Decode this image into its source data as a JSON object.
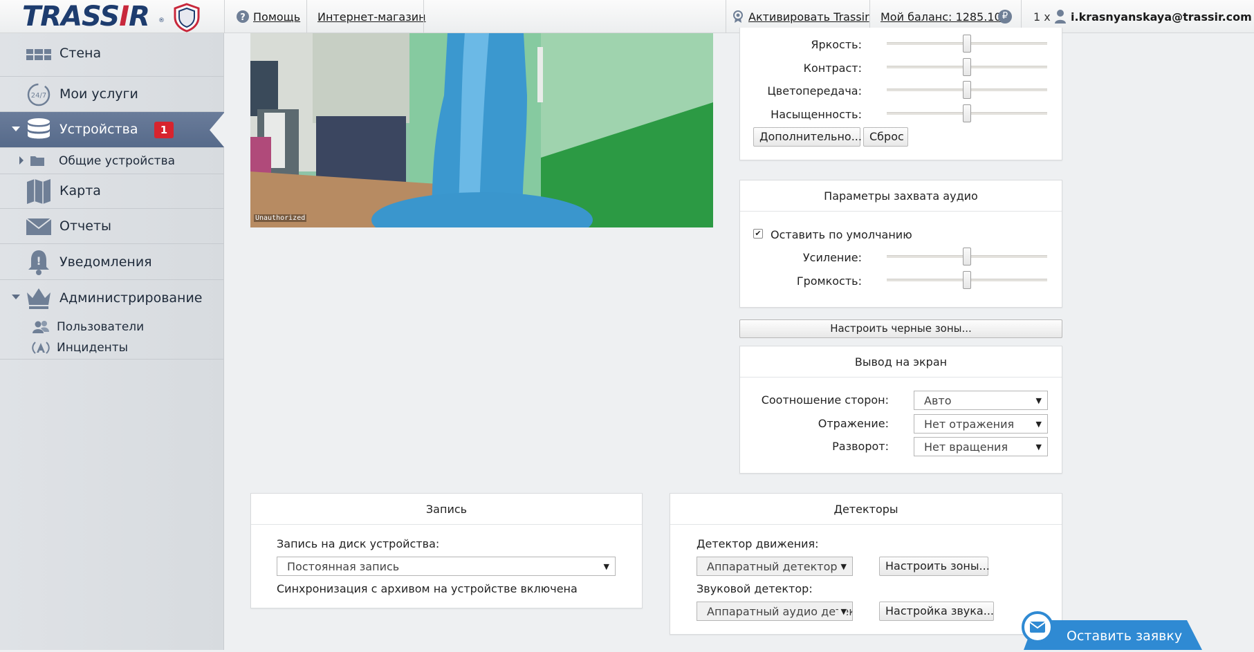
{
  "topbar": {
    "brand": "TRASSIR",
    "help": "Помощь",
    "shop": "Интернет-магазин",
    "activate": "Активировать Trassir",
    "balance": "Мой баланс: 1285.10",
    "currency": "₽",
    "user_count": "1 x",
    "email": "i.krasnyanskaya@trassir.com"
  },
  "sidebar": {
    "items": [
      {
        "label": "Стена",
        "icon": "wall-icon"
      },
      {
        "label": "Мои услуги",
        "icon": "services-24-7-icon"
      },
      {
        "label": "Устройства",
        "icon": "database-icon",
        "badge": "1",
        "active": true
      },
      {
        "label": "Карта",
        "icon": "map-icon"
      },
      {
        "label": "Отчеты",
        "icon": "envelope-icon"
      },
      {
        "label": "Уведомления",
        "icon": "bell-icon"
      },
      {
        "label": "Администрирование",
        "icon": "crown-icon"
      }
    ],
    "devices_sub": "Общие устройства",
    "admin_sub": [
      "Пользователи",
      "Инциденты"
    ]
  },
  "video": {
    "watermark": "Unauthorized"
  },
  "image_settings": {
    "brightness": "Яркость:",
    "contrast": "Контраст:",
    "color": "Цветопередача:",
    "saturation": "Насыщенность:",
    "brightness_level": 0.5,
    "contrast_level": 0.5,
    "color_level": 0.5,
    "saturation_level": 0.5,
    "more_button": "Дополнительно...",
    "reset_button": "Сброс"
  },
  "audio_capture": {
    "title": "Параметры захвата аудио",
    "default_checkbox": "Оставить по умолчанию",
    "default_checked": true,
    "gain": "Усиление:",
    "volume": "Громкость:",
    "gain_level": 0.5,
    "volume_level": 0.5
  },
  "black_zones_button": "Настроить черные зоны...",
  "display_output": {
    "title": "Вывод на экран",
    "aspect_label": "Соотношение сторон:",
    "aspect_value": "Авто",
    "mirror_label": "Отражение:",
    "mirror_value": "Нет отражения",
    "rotate_label": "Разворот:",
    "rotate_value": "Нет вращения"
  },
  "recording": {
    "title": "Запись",
    "disk_label": "Запись на диск устройства:",
    "disk_value": "Постоянная запись",
    "sync_text": "Синхронизация с архивом на устройстве включена"
  },
  "detectors": {
    "title": "Детекторы",
    "motion_label": "Детектор движения:",
    "motion_value": "Аппаратный детектор",
    "motion_zones_button": "Настроить зоны...",
    "sound_label": "Звуковой детектор:",
    "sound_value": "Аппаратный аудио детектор",
    "sound_button": "Настройка звука..."
  },
  "cta": {
    "label": "Оставить заявку"
  },
  "colors": {
    "accent": "#2f8ad3",
    "active_nav": "#5e7193",
    "badge": "#d7242e",
    "brand_dark": "#1d3c6e",
    "brand_red": "#c8283c"
  }
}
